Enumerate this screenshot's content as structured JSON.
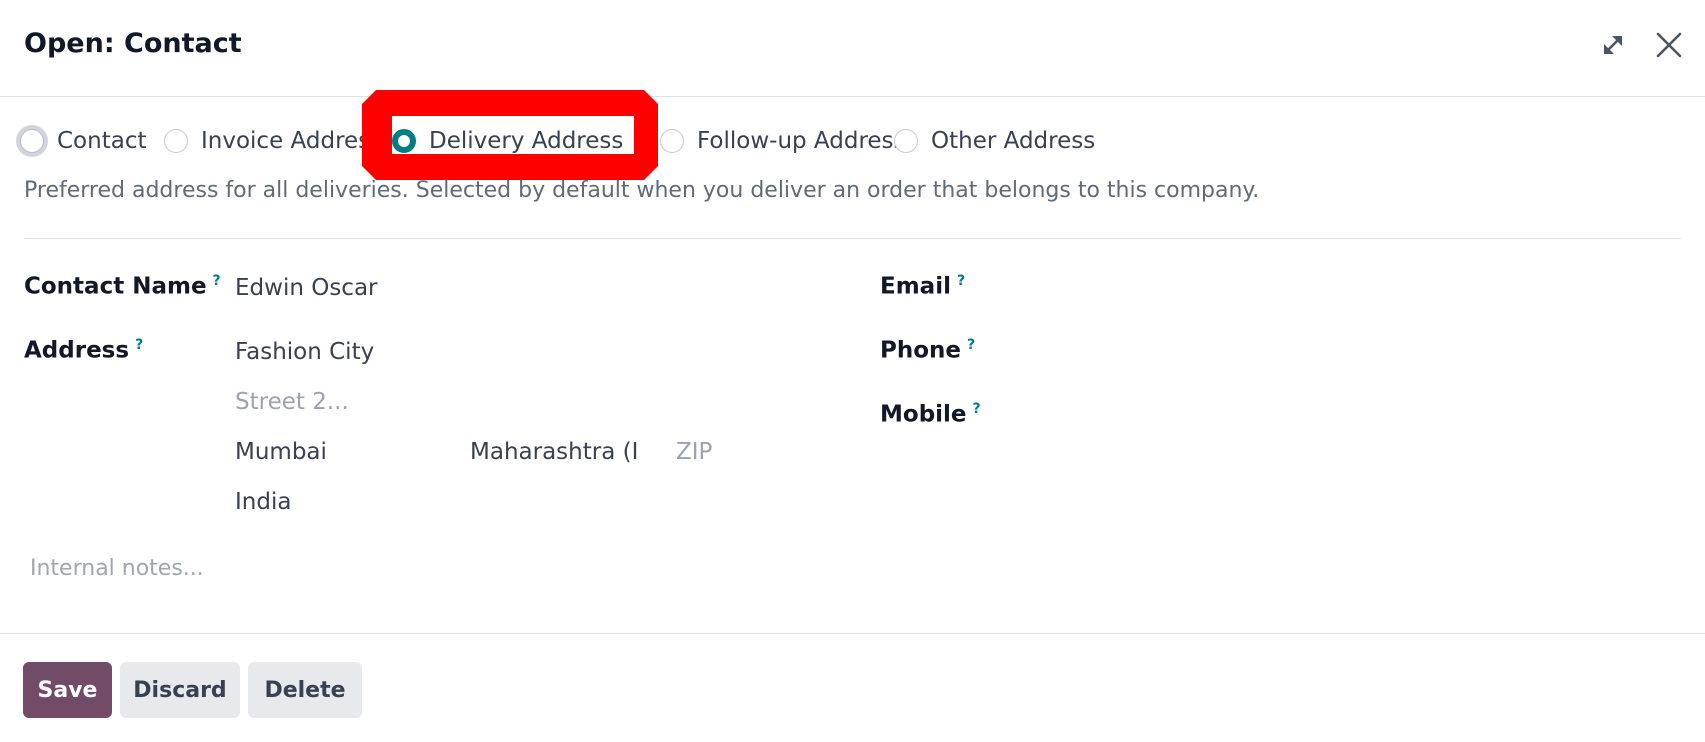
{
  "dialog": {
    "title": "Open: Contact"
  },
  "address_types": [
    {
      "label": "Contact",
      "checked": false
    },
    {
      "label": "Invoice Address",
      "checked": false
    },
    {
      "label": "Delivery Address",
      "checked": true
    },
    {
      "label": "Follow-up Address",
      "checked": false
    },
    {
      "label": "Other Address",
      "checked": false
    }
  ],
  "description": "Preferred address for all deliveries. Selected by default when you deliver an order that belongs to this company.",
  "fields": {
    "contact_name": {
      "label": "Contact Name",
      "help": "?",
      "value": "Edwin Oscar"
    },
    "address": {
      "label": "Address",
      "help": "?",
      "street": "Fashion City",
      "street2_placeholder": "Street 2...",
      "city": "Mumbai",
      "state": "Maharashtra (IN)",
      "zip_placeholder": "ZIP",
      "country": "India"
    },
    "email": {
      "label": "Email",
      "help": "?"
    },
    "phone": {
      "label": "Phone",
      "help": "?"
    },
    "mobile": {
      "label": "Mobile",
      "help": "?"
    }
  },
  "notes_placeholder": "Internal notes...",
  "buttons": {
    "save": "Save",
    "discard": "Discard",
    "delete": "Delete"
  },
  "colors": {
    "primary": "#714b67",
    "accent": "#017e84",
    "highlight": "#ff0000"
  },
  "icons": {
    "expand": "expand-icon",
    "close": "close-icon"
  }
}
